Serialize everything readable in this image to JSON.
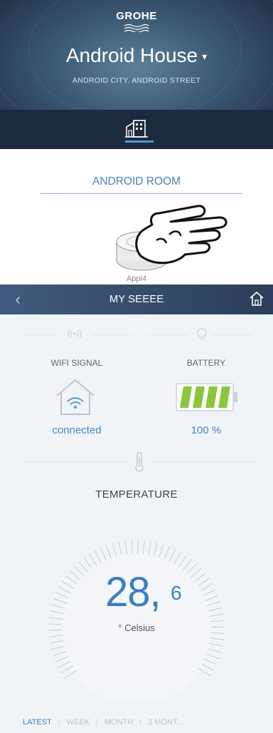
{
  "brand": {
    "name": "GROHE"
  },
  "house": {
    "name": "Android House",
    "caret": "▾",
    "address": "ANDROID CITY, ANDROID STREET"
  },
  "room": {
    "name": "ANDROID ROOM",
    "device_label": "Appl4"
  },
  "device_screen": {
    "back": "‹",
    "title": "MY SEEEE",
    "wifi": {
      "label": "WIFI SIGNAL",
      "status": "connected"
    },
    "battery": {
      "label": "BATTERY",
      "value": "100 %",
      "level_fraction": 1.0
    },
    "temperature": {
      "label": "TEMPERATURE",
      "integer": "28,",
      "decimal": "6",
      "unit": "° Celsius"
    },
    "periods": [
      "LATEST",
      "WEEK",
      "MONTH",
      "3 MONT..."
    ],
    "period_separator": "|"
  },
  "colors": {
    "accent_blue": "#3a7fc2",
    "battery_green": "#8cc63f",
    "header_dark": "#1c2a3d"
  }
}
